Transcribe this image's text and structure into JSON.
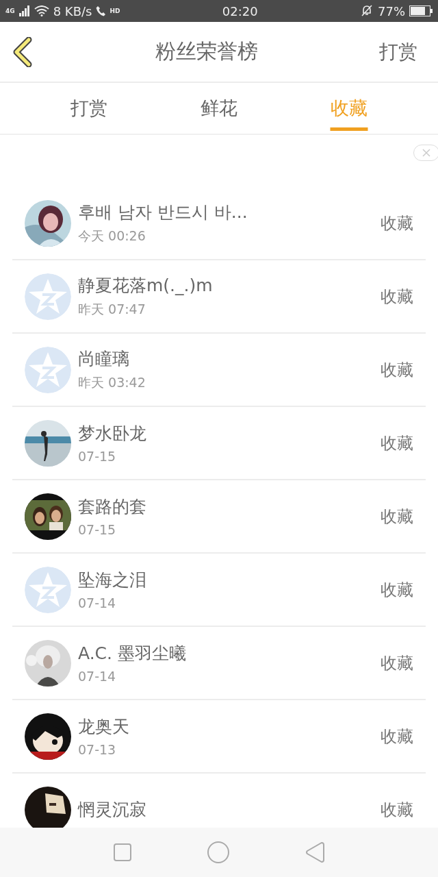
{
  "status_bar": {
    "network": "4G",
    "speed": "8 KB/s",
    "call_badge": "HD",
    "time": "02:20",
    "battery": "77%"
  },
  "header": {
    "title": "粉丝荣誉榜",
    "action": "打赏"
  },
  "tabs": [
    {
      "label": "打赏",
      "selected": false
    },
    {
      "label": "鲜花",
      "selected": false
    },
    {
      "label": "收藏",
      "selected": true
    }
  ],
  "fans": [
    {
      "name": "후배 남자 반드시 바...",
      "time": "今天 00:26",
      "action": "收藏"
    },
    {
      "name": "静夏花落m(._.)m",
      "time": "昨天 07:47",
      "action": "收藏",
      "avatar": {
        "kind": "default"
      }
    },
    {
      "name": "尚瞳璃",
      "time": "昨天 03:42",
      "action": "收藏",
      "avatar": {
        "kind": "default"
      }
    },
    {
      "name": "梦水卧龙",
      "time": "07-15",
      "action": "收藏"
    },
    {
      "name": "套路的套",
      "time": "07-15",
      "action": "收藏"
    },
    {
      "name": "坠海之泪",
      "time": "07-14",
      "action": "收藏",
      "avatar": {
        "kind": "default"
      }
    },
    {
      "name": "A.C. 墨羽尘曦",
      "time": "07-14",
      "action": "收藏"
    },
    {
      "name": "龙奥天",
      "time": "07-13",
      "action": "收藏"
    },
    {
      "name": "惘灵沉寂",
      "action": "收藏"
    }
  ]
}
